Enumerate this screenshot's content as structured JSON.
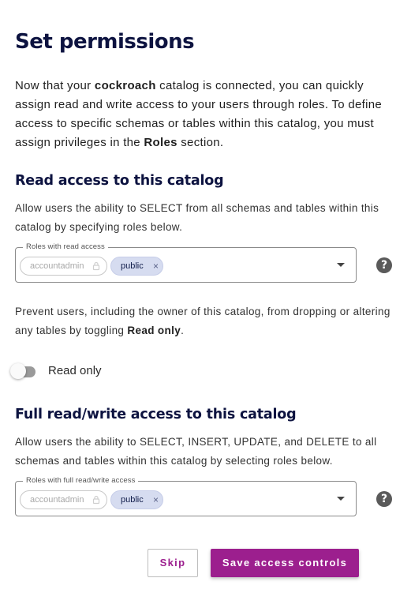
{
  "title": "Set permissions",
  "intro": {
    "part1": "Now that your ",
    "catalog_name": "cockroach",
    "part2": " catalog is connected, you can quickly assign read and write access to your users through roles. To define access to specific schemas or tables within this catalog, you must assign privileges in the ",
    "roles_link": "Roles",
    "part3": " section."
  },
  "read_section": {
    "heading": "Read access to this catalog",
    "description": "Allow users the ability to SELECT from all schemas and tables within this catalog by specifying roles below.",
    "field_label": "Roles with read access",
    "chips": [
      {
        "label": "accountadmin",
        "disabled": true,
        "icon": "lock-icon"
      },
      {
        "label": "public",
        "removable": true,
        "icon": "close-icon"
      }
    ],
    "prevent_text_1": "Prevent users, including the owner of this catalog, from dropping or altering any tables by toggling ",
    "prevent_bold": "Read only",
    "prevent_text_2": ".",
    "toggle_label": "Read only",
    "toggle_on": false
  },
  "write_section": {
    "heading": "Full read/write access to this catalog",
    "description": "Allow users the ability to SELECT, INSERT, UPDATE, and DELETE to all schemas and tables within this catalog by selecting roles below.",
    "field_label": "Roles with full read/write access",
    "chips": [
      {
        "label": "accountadmin",
        "disabled": true,
        "icon": "lock-icon"
      },
      {
        "label": "public",
        "removable": true,
        "icon": "close-icon"
      }
    ]
  },
  "help_glyph": "?",
  "chip_remove_glyph": "×",
  "buttons": {
    "skip": "Skip",
    "save": "Save access controls"
  },
  "colors": {
    "heading": "#0d1340",
    "accent": "#9c1f8e",
    "chip_bg": "#d6dcf0"
  }
}
